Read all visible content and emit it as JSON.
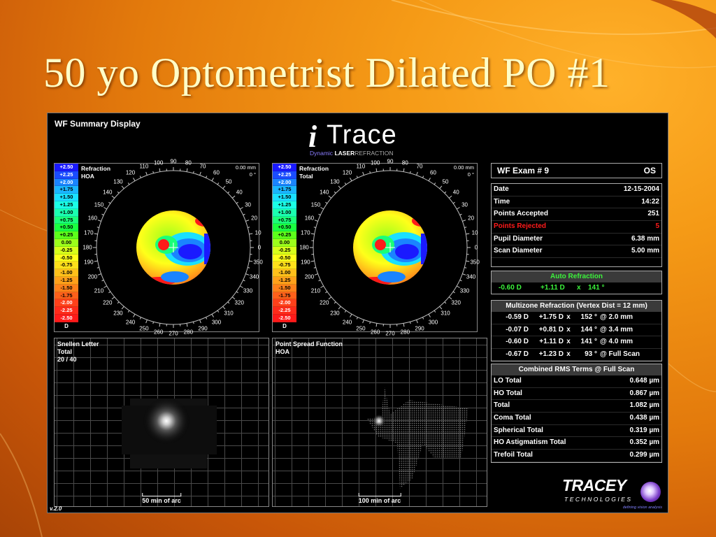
{
  "slide": {
    "title": "50 yo Optometrist Dilated PO #1"
  },
  "app": {
    "panel_title": "WF Summary Display",
    "brand": {
      "mark": "i",
      "word": "Trace",
      "tagline_dynamic": "Dynamic",
      "tagline_laser": "LASER",
      "tagline_refraction": "EFRACTION"
    },
    "version": "v.2.0"
  },
  "scale": {
    "values": [
      "+2.50",
      "+2.25",
      "+2.00",
      "+1.75",
      "+1.50",
      "+1.25",
      "+1.00",
      "+0.75",
      "+0.50",
      "+0.25",
      "0.00",
      "-0.25",
      "-0.50",
      "-0.75",
      "-1.00",
      "-1.25",
      "-1.50",
      "-1.75",
      "-2.00",
      "-2.25",
      "-2.50"
    ],
    "colors": [
      "#1a1aff",
      "#1a4cff",
      "#1a84ff",
      "#1ab6ff",
      "#1ae0ff",
      "#1affe6",
      "#1affb0",
      "#1aff78",
      "#1aff40",
      "#5cff1a",
      "#9cff1a",
      "#d8ff1a",
      "#ffff1a",
      "#ffe01a",
      "#ffc01a",
      "#ffa01a",
      "#ff801a",
      "#ff601a",
      "#ff401a",
      "#ff2a1a",
      "#ff1a1a"
    ],
    "unit": "D"
  },
  "refraction_hoa": {
    "label1": "Refraction",
    "label2": "HOA",
    "mm": "0.00 mm",
    "deg": "0 °"
  },
  "refraction_total": {
    "label1": "Refraction",
    "label2": "Total",
    "mm": "0.00 mm",
    "deg": "0 °"
  },
  "degree_labels": [
    "0",
    "10",
    "20",
    "30",
    "40",
    "50",
    "60",
    "70",
    "80",
    "90",
    "100",
    "110",
    "120",
    "130",
    "140",
    "150",
    "160",
    "170",
    "180",
    "190",
    "200",
    "210",
    "220",
    "230",
    "240",
    "250",
    "260",
    "270",
    "280",
    "290",
    "300",
    "310",
    "320",
    "330",
    "340",
    "350"
  ],
  "snellen": {
    "label1": "Snellen Letter",
    "label2": "Total",
    "label3": "20 / 40",
    "scale": "50 min of arc"
  },
  "psf": {
    "label1": "Point Spread Function",
    "label2": "HOA",
    "scale": "100 min of arc"
  },
  "exam": {
    "title": "WF Exam  # 9",
    "eye": "OS",
    "rows": [
      {
        "label": "Date",
        "value": "12-15-2004"
      },
      {
        "label": "Time",
        "value": "14:22"
      },
      {
        "label": "Points Accepted",
        "value": "251"
      },
      {
        "label": "Points Rejected",
        "value": "5"
      },
      {
        "label": "Pupil Diameter",
        "value": "6.38 mm"
      },
      {
        "label": "Scan Diameter",
        "value": "5.00 mm"
      }
    ]
  },
  "auto_refraction": {
    "title": "Auto Refraction",
    "sphere": "-0.60 D",
    "cyl": "+1.11 D",
    "x": "x",
    "axis": "141 °"
  },
  "multizone": {
    "title": "Multizone Refraction  (Vertex Dist = 12 mm)",
    "rows": [
      {
        "sph": "-0.59 D",
        "cyl": "+1.75 D",
        "x": "x",
        "axis": "152 °",
        "zone": "@ 2.0 mm"
      },
      {
        "sph": "-0.07 D",
        "cyl": "+0.81 D",
        "x": "x",
        "axis": "144 °",
        "zone": "@ 3.4 mm"
      },
      {
        "sph": "-0.60 D",
        "cyl": "+1.11 D",
        "x": "x",
        "axis": "141 °",
        "zone": "@ 4.0 mm"
      },
      {
        "sph": "-0.67 D",
        "cyl": "+1.23 D",
        "x": "x",
        "axis": "93 °",
        "zone": "@ Full Scan"
      }
    ]
  },
  "rms": {
    "title": "Combined RMS Terms @ Full Scan",
    "rows": [
      {
        "label": "LO Total",
        "value": "0.648 µm"
      },
      {
        "label": "HO Total",
        "value": "0.867 µm"
      },
      {
        "label": "Total",
        "value": "1.082 µm"
      },
      {
        "label": "Coma Total",
        "value": "0.438 µm"
      },
      {
        "label": "Spherical Total",
        "value": "0.319 µm"
      },
      {
        "label": "HO Astigmatism Total",
        "value": "0.352 µm"
      },
      {
        "label": "Trefoil Total",
        "value": "0.299 µm"
      }
    ]
  },
  "logo": {
    "name": "TRACEY",
    "sub": "TECHNOLOGIES",
    "motto": "defining vision analysis"
  }
}
